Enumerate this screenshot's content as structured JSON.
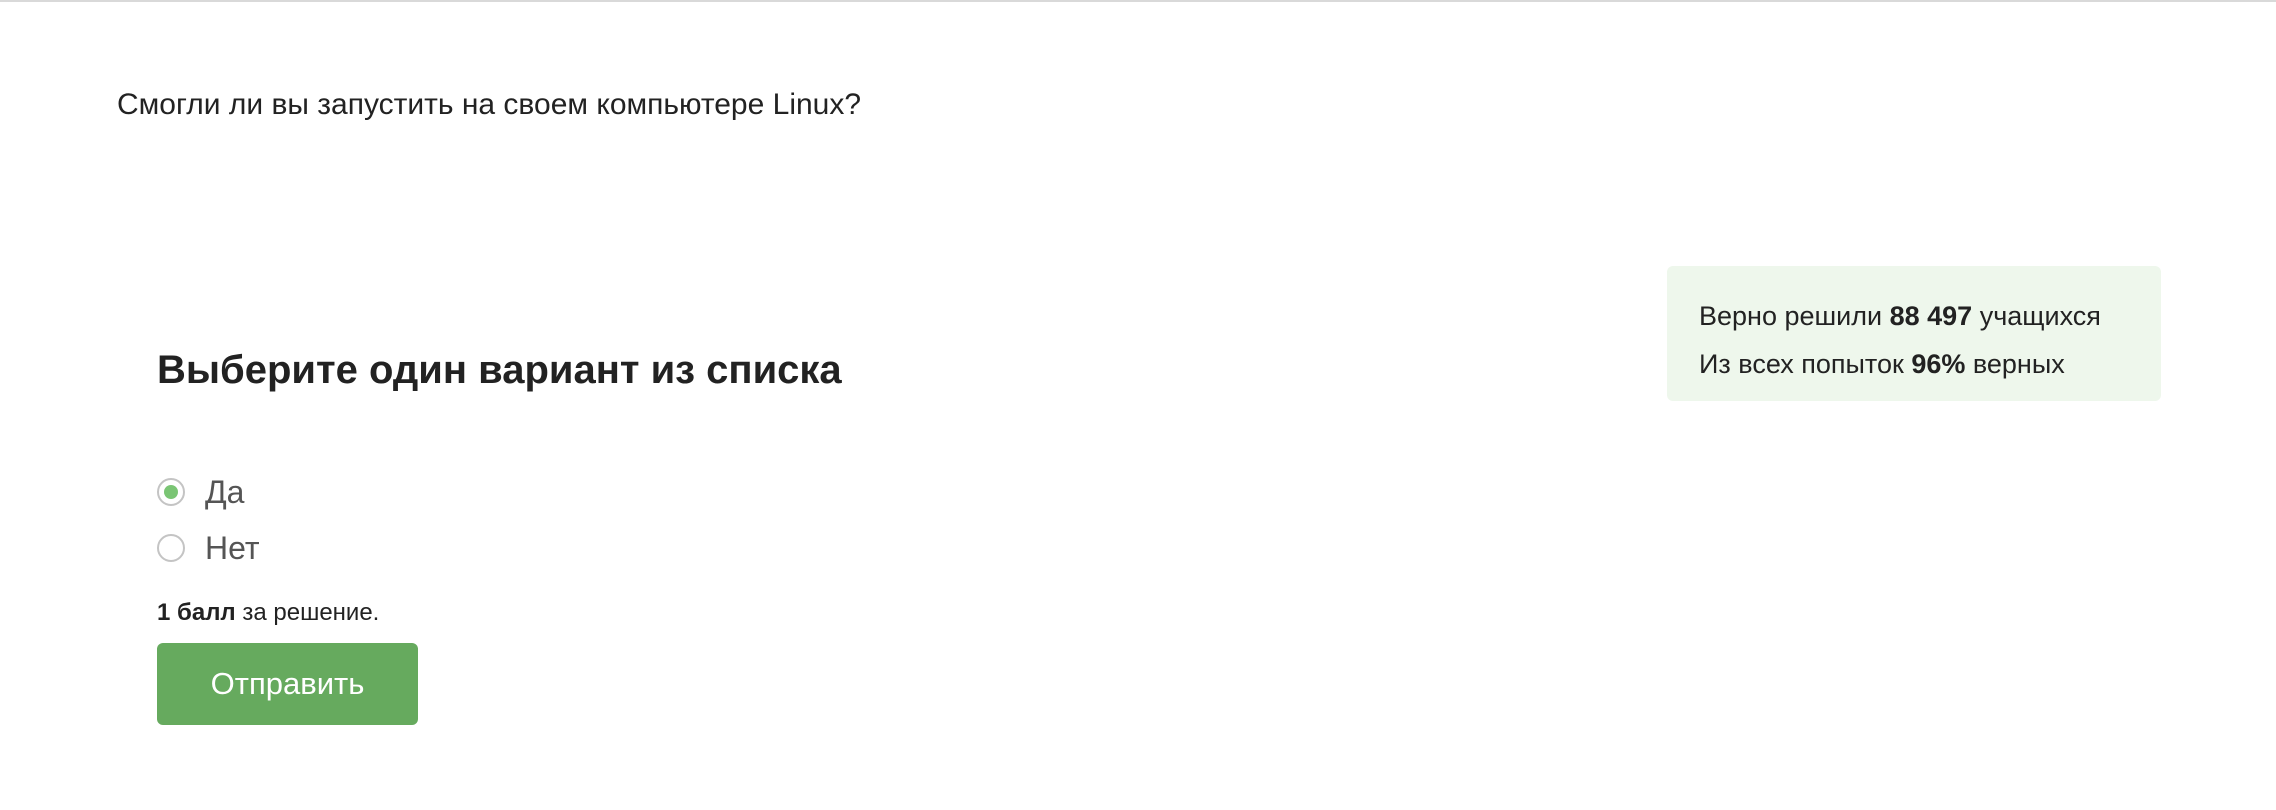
{
  "question": {
    "text": "Смогли ли вы запустить на своем компьютере Linux?"
  },
  "stats": {
    "solved_prefix": "Верно решили ",
    "solved_count": "88 497",
    "solved_suffix": " учащихся",
    "attempts_prefix": "Из всех попыток ",
    "attempts_percent": "96%",
    "attempts_suffix": " верных"
  },
  "quiz": {
    "heading": "Выберите один вариант из списка",
    "options": [
      {
        "label": "Да",
        "selected": true
      },
      {
        "label": "Нет",
        "selected": false
      }
    ],
    "score_bold": "1 балл",
    "score_rest": " за решение.",
    "submit_label": "Отправить"
  },
  "colors": {
    "accent": "#66aa5e",
    "radio_selected": "#7ac574",
    "stats_bg": "#eef7ec"
  }
}
